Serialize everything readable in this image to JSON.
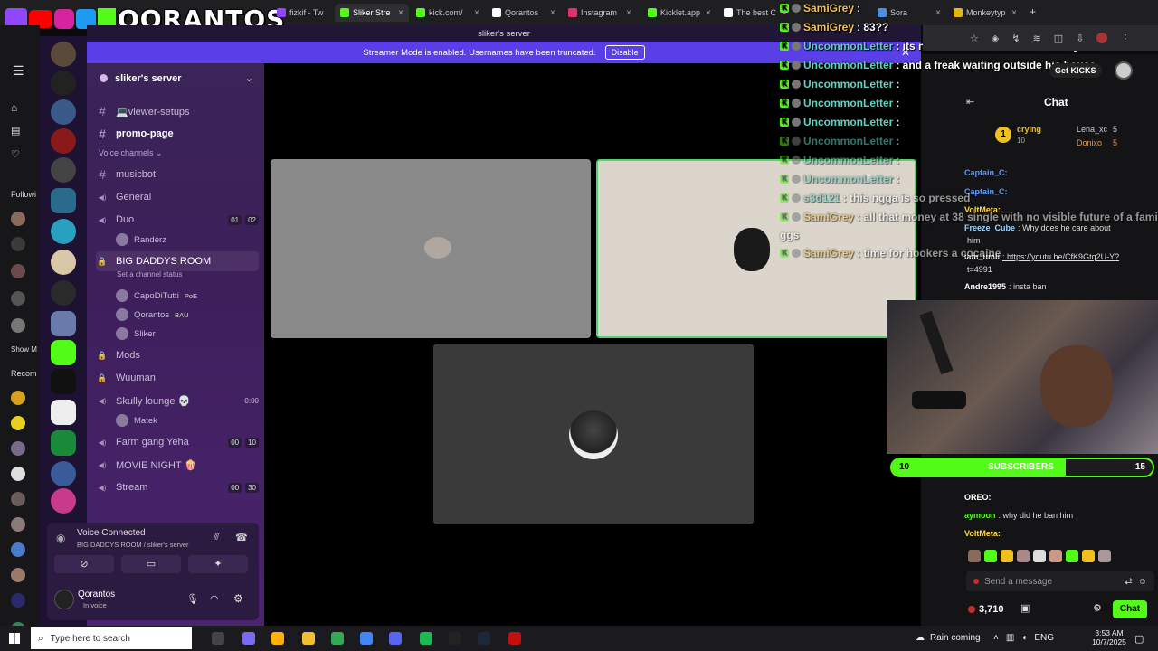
{
  "browser": {
    "tabs": [
      {
        "label": "fizkif - Tw",
        "color": "#9146ff"
      },
      {
        "label": "Sliker Stre",
        "color": "#53fc18",
        "active": true
      },
      {
        "label": "kick.com/",
        "color": "#53fc18"
      },
      {
        "label": "Qorantos",
        "color": "#ffffff"
      },
      {
        "label": "Instagram",
        "color": "#e1306c"
      },
      {
        "label": "Kicklet.app",
        "color": "#53fc18"
      },
      {
        "label": "The best C",
        "color": "#ffffff"
      },
      {
        "label": "Sora",
        "color": "#4a90e2"
      },
      {
        "label": "Monkeytyp",
        "color": "#e2b714"
      }
    ],
    "new_tab": "+",
    "get_kicks": "Get KICKS"
  },
  "branding": {
    "logo_text": "QORANTOS"
  },
  "kick_sidebar": {
    "following": "Followi",
    "show_more": "Show M",
    "recommended": "Recom"
  },
  "discord": {
    "window_title": "sliker's server",
    "streamer_mode_text": "Streamer Mode is enabled. Usernames have been truncated.",
    "disable_button": "Disable",
    "server_name": "sliker's server",
    "channels": [
      {
        "type": "text",
        "label": "💻viewer-setups"
      },
      {
        "type": "text",
        "label": "promo-page",
        "bold": true
      },
      {
        "type": "category",
        "label": "Voice channels"
      },
      {
        "type": "text",
        "label": "musicbot"
      },
      {
        "type": "voice",
        "label": "General"
      },
      {
        "type": "voice",
        "label": "Duo",
        "counts": [
          "01",
          "02"
        ]
      },
      {
        "type": "user",
        "label": "Randerz"
      },
      {
        "type": "voice-locked",
        "label": "BIG DADDYS ROOM",
        "active": true
      },
      {
        "type": "status",
        "label": "Set a channel status"
      },
      {
        "type": "user",
        "label": "CapoDiTutti",
        "tag": "PoE"
      },
      {
        "type": "user",
        "label": "Qorantos",
        "tag": "BAU"
      },
      {
        "type": "user",
        "label": "Sliker"
      },
      {
        "type": "text-locked",
        "label": "Mods"
      },
      {
        "type": "text-locked",
        "label": "Wuuman"
      },
      {
        "type": "voice",
        "label": "Skully lounge 💀",
        "time": "0:00"
      },
      {
        "type": "user",
        "label": "Matek"
      },
      {
        "type": "voice",
        "label": "Farm gang Yeha",
        "counts": [
          "00",
          "10"
        ]
      },
      {
        "type": "voice",
        "label": "MOVIE NIGHT 🍿"
      },
      {
        "type": "voice",
        "label": "Stream",
        "counts": [
          "00",
          "30"
        ]
      }
    ],
    "voice_panel": {
      "status": "Voice Connected",
      "location": "BIG DADDYS ROOM / sliker's server"
    },
    "user_panel": {
      "name": "Qorantos",
      "status": "In voice"
    }
  },
  "overlay_chat": [
    {
      "name": "SamiGrey",
      "text": " : ",
      "name_style": "grey"
    },
    {
      "name": "SamiGrey",
      "text": " : 83??",
      "name_style": "grey"
    },
    {
      "name": "UncommonLetter",
      "text": " : its not a saudi she lied she was syrian",
      "name_style": "un"
    },
    {
      "name": "UncommonLetter",
      "text": " : and a freak waiting outside his house",
      "name_style": "un"
    },
    {
      "name": "UncommonLetter",
      "text": " : ",
      "name_style": "un"
    },
    {
      "name": "UncommonLetter",
      "text": " : ",
      "name_style": "un"
    },
    {
      "name": "UncommonLetter",
      "text": " : ",
      "name_style": "un"
    },
    {
      "name": "UncommonLetter",
      "text": " : ",
      "name_style": "un",
      "faded": true
    },
    {
      "name": "UncommonLetter",
      "text": " : ",
      "name_style": "un",
      "faded": true
    },
    {
      "name": "UncommonLetter",
      "text": " : ",
      "name_style": "un",
      "faded": true
    },
    {
      "name": "s3d121",
      "text": " : this ngga is so pressed",
      "name_style": "un",
      "faded": true
    },
    {
      "name": "SamiGrey",
      "text": " : all that money at 38 single with no visible future of a family",
      "name_style": "grey",
      "faded": true
    },
    {
      "name": "",
      "text": "ggs",
      "name_style": "grey",
      "faded": true
    },
    {
      "name": "SamiGrey",
      "text": " : time for hookers a cocaine",
      "name_style": "grey",
      "faded": true
    }
  ],
  "kick_chat": {
    "title": "Chat",
    "leaderboard": [
      {
        "rank": "1",
        "name": "crying",
        "count": "10"
      },
      {
        "name": "Lena_xc",
        "count": "5"
      },
      {
        "name": "Donixo",
        "count": "5"
      }
    ],
    "messages": [
      {
        "name": "Captain_C:",
        "text": "",
        "color": "#5a9cff"
      },
      {
        "name": "Captain_C:",
        "text": "",
        "color": "#5a9cff"
      },
      {
        "name": "VoltMeta:",
        "text": "",
        "color": "#ffd84a"
      },
      {
        "name": "Freeze_Cube",
        "text": ": Why does he care about",
        "color": "#9ad3ff"
      },
      {
        "name": "",
        "text": "him",
        "color": "#ddd"
      },
      {
        "name": "iam_umii",
        "text": ": https://youtu.be/CfK9Gtq2U-Y?",
        "color": "#ffffff"
      },
      {
        "name": "",
        "text": "t=4991",
        "color": "#ddd"
      },
      {
        "name": "Andre1995",
        "text": ": insta ban",
        "color": "#ffffff"
      },
      {
        "name": "OREO:",
        "text": "",
        "color": "#ffffff"
      },
      {
        "name": "aymoon",
        "text": ": why did he ban him",
        "color": "#53fc18"
      },
      {
        "name": "VoltMeta:",
        "text": "",
        "color": "#ffd84a"
      }
    ],
    "message_placeholder": "Send a message",
    "viewers": "3,710",
    "chat_button": "Chat"
  },
  "subscribers": {
    "left": "10",
    "label": "SUBSCRIBERS",
    "right": "15",
    "fill_percent": 66.7
  },
  "taskbar": {
    "search_placeholder": "Type here to search",
    "weather": "Rain coming",
    "lang": "ENG",
    "time": "3:53 AM",
    "date": "10/7/2025"
  }
}
